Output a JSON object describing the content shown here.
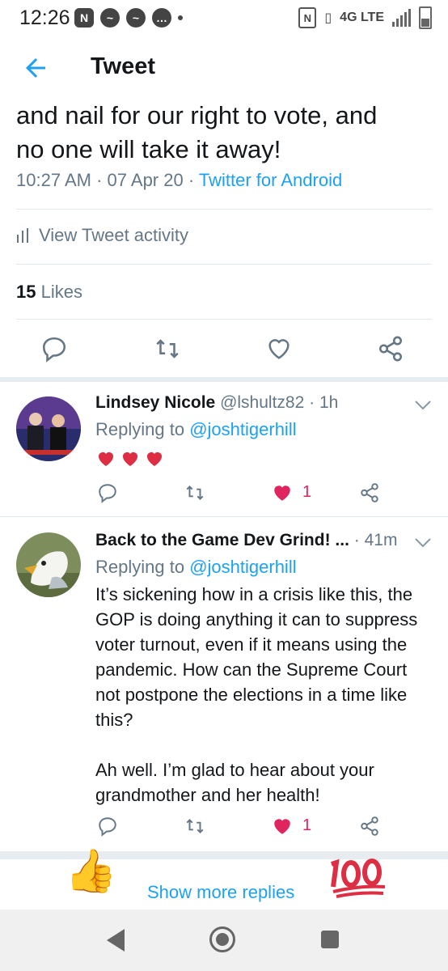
{
  "status_bar": {
    "time": "12:26",
    "network": "4G LTE"
  },
  "header": {
    "title": "Tweet",
    "back_icon": "arrow-left-icon"
  },
  "tweet": {
    "text": "and nail for our right to vote, and\nno one will take it away!",
    "time": "10:27 AM",
    "date": "07 Apr 20",
    "source": "Twitter for Android",
    "activity_label": "View Tweet activity",
    "likes_count": "15",
    "likes_label": "Likes"
  },
  "replies": [
    {
      "name": "Lindsey Nicole",
      "handle": "@lshultz82",
      "age": "1h",
      "replying_label": "Replying to",
      "replying_handle": "@joshtigerhill",
      "body": "♥♥♥",
      "like_count": "1",
      "liked": true
    },
    {
      "name": "Back to the Game Dev Grind! ...",
      "handle": "",
      "age": "41m",
      "replying_label": "Replying to",
      "replying_handle": "@joshtigerhill",
      "body": "It’s sickening how in a crisis like this, the\nGOP is doing anything it can to suppress\nvoter turnout, even if it means using the\npandemic. How can the Supreme Court\nnot postpone the elections in a time like\nthis?\n\nAh well. I’m glad to hear about your\ngrandmother and her health!",
      "like_count": "1",
      "liked": true
    }
  ],
  "show_more": "Show more replies",
  "colors": {
    "accent": "#1da1f2",
    "like": "#e0245e",
    "secondary_text": "#657786"
  }
}
